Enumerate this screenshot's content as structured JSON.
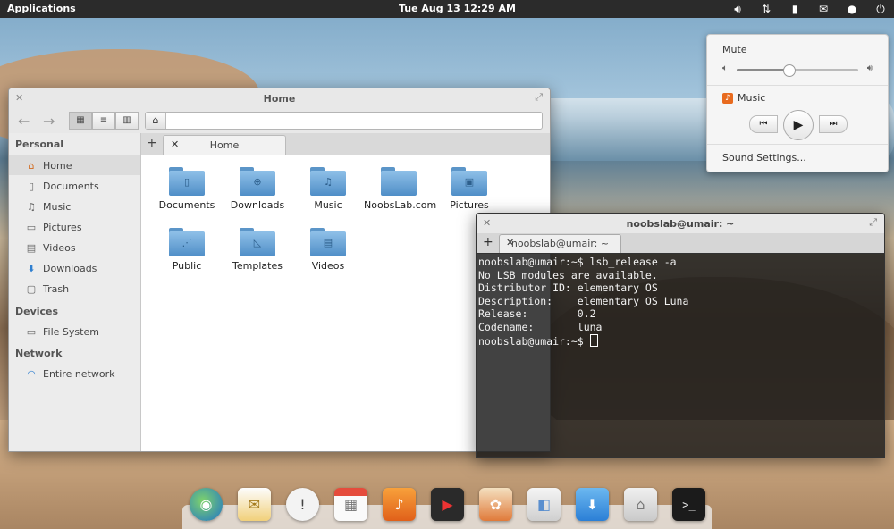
{
  "top_panel": {
    "applications": "Applications",
    "clock": "Tue Aug 13 12:29 AM"
  },
  "tray_icons": [
    "volume-icon",
    "network-icon",
    "battery-icon",
    "mail-icon",
    "user-icon",
    "power-icon"
  ],
  "sound_popover": {
    "mute_label": "Mute",
    "volume_level": 0.43,
    "music_label": "Music",
    "settings_label": "Sound Settings..."
  },
  "file_manager": {
    "title": "Home",
    "tab_label": "Home",
    "sidebar": {
      "personal_header": "Personal",
      "personal_items": [
        "Home",
        "Documents",
        "Music",
        "Pictures",
        "Videos",
        "Downloads",
        "Trash"
      ],
      "devices_header": "Devices",
      "devices_items": [
        "File System"
      ],
      "network_header": "Network",
      "network_items": [
        "Entire network"
      ]
    },
    "files": [
      "Documents",
      "Downloads",
      "Music",
      "NoobsLab.com",
      "Pictures",
      "Public",
      "Templates",
      "Videos"
    ]
  },
  "terminal": {
    "title": "noobslab@umair: ~",
    "tab_label": "noobslab@umair: ~",
    "lines": [
      "noobslab@umair:~$ lsb_release -a",
      "No LSB modules are available.",
      "Distributor ID: elementary OS",
      "Description:    elementary OS Luna",
      "Release:        0.2",
      "Codename:       luna",
      "noobslab@umair:~$ "
    ]
  },
  "dock": [
    "web-browser-icon",
    "mail-app-icon",
    "notifications-icon",
    "calendar-icon",
    "music-player-icon",
    "video-player-icon",
    "photos-icon",
    "system-settings-icon",
    "app-center-icon",
    "files-icon",
    "terminal-icon"
  ]
}
